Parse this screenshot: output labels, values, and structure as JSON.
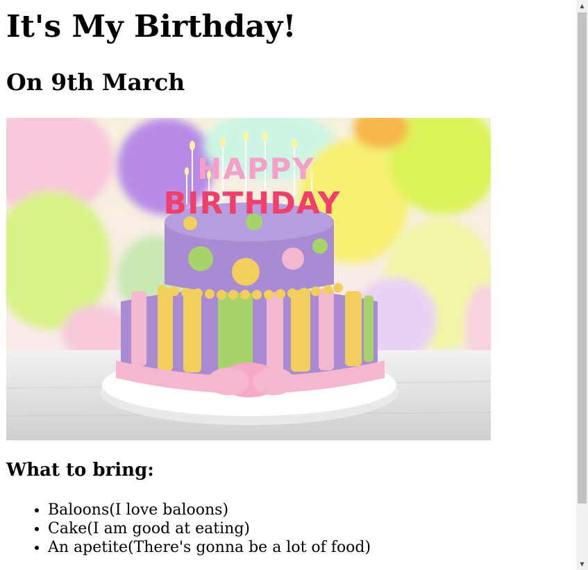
{
  "page": {
    "title": "It's My Birthday!",
    "date": "On 9th March",
    "section_heading": "What to bring:",
    "items": [
      "Baloons(I love baloons)",
      "Cake(I am good at eating)",
      "An apetite(There's gonna be a lot of food)"
    ]
  },
  "image": {
    "topper_line1": "HAPPY",
    "topper_line2": "BIRTHDAY"
  },
  "scrollbar": {
    "up_arrow": "▲",
    "down_arrow": "▼"
  },
  "colors": {
    "background": "#ffffff",
    "text": "#000000",
    "cake_purple": "#a98bd3",
    "cake_yellow": "#f2cf5c",
    "cake_green": "#a6d36a",
    "cake_pink": "#f3b7cf"
  }
}
